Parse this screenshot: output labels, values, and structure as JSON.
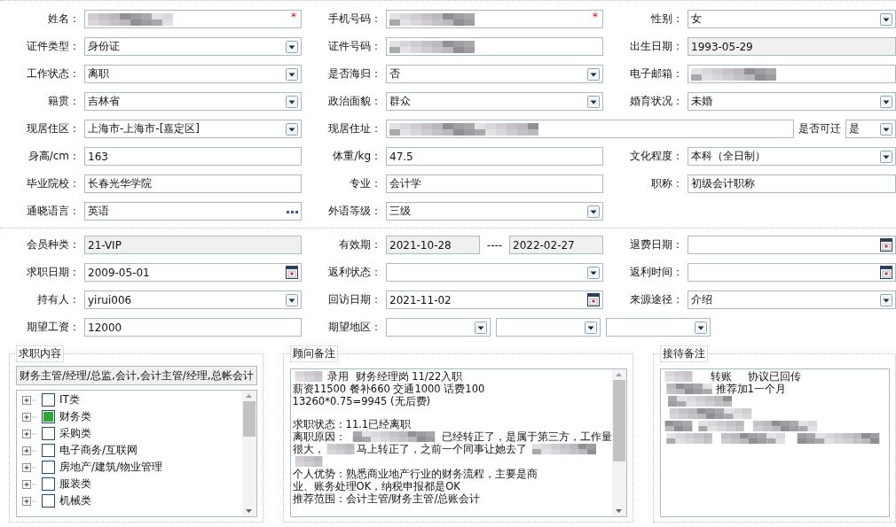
{
  "basic_info": {
    "rows": [
      [
        {
          "label": "姓名：",
          "kind": "text",
          "redacted": true,
          "required_mark": "*"
        },
        {
          "label": "手机号码：",
          "kind": "text",
          "redacted": true,
          "required_mark": "*"
        },
        {
          "label": "性别：",
          "kind": "select",
          "value": "女"
        }
      ],
      [
        {
          "label": "证件类型：",
          "kind": "select",
          "value": "身份证"
        },
        {
          "label": "证件号码：",
          "kind": "text",
          "redacted": true
        },
        {
          "label": "出生日期：",
          "kind": "text",
          "value": "1993-05-29",
          "readonly": true
        }
      ],
      [
        {
          "label": "工作状态：",
          "kind": "select",
          "value": "离职"
        },
        {
          "label": "是否海归：",
          "kind": "select",
          "value": "否"
        },
        {
          "label": "电子邮箱：",
          "kind": "text",
          "redacted": true
        }
      ],
      [
        {
          "label": "籍贯：",
          "kind": "select",
          "value": "吉林省"
        },
        {
          "label": "政治面貌：",
          "kind": "select",
          "value": "群众"
        },
        {
          "label": "婚育状况：",
          "kind": "select",
          "value": "未婚"
        }
      ],
      [
        {
          "label": "现居住区：",
          "kind": "select",
          "value": " 上海市-上海市-[嘉定区]"
        },
        {
          "label": "现居住址：",
          "kind": "wide",
          "redacted": true
        },
        {
          "label": "是否可迁",
          "kind": "select",
          "value": "是"
        }
      ],
      [
        {
          "label": "身高/cm：",
          "kind": "text",
          "value": "163"
        },
        {
          "label": "体重/kg：",
          "kind": "text",
          "value": "47.5"
        },
        {
          "label": "文化程度：",
          "kind": "select",
          "value": "本科（全日制）"
        }
      ],
      [
        {
          "label": "毕业院校：",
          "kind": "text",
          "value": "长春光华学院"
        },
        {
          "label": "专业：",
          "kind": "text",
          "value": "会计学"
        },
        {
          "label": "职称：",
          "kind": "text",
          "value": "初级会计职称"
        }
      ],
      [
        {
          "label": "通晓语言：",
          "kind": "lookup",
          "value": "英语"
        },
        {
          "label": "外语等级：",
          "kind": "select",
          "value": "三级"
        }
      ]
    ]
  },
  "membership": {
    "rows": [
      [
        {
          "label": "会员种类：",
          "kind": "text",
          "value": "21-VIP",
          "readonly": true
        },
        {
          "label": "有效期：",
          "kind": "range",
          "values": [
            "2021-10-28",
            "2022-02-27"
          ],
          "separator": "----",
          "readonly": true
        },
        {
          "label": "退费日期：",
          "kind": "date"
        }
      ],
      [
        {
          "label": "求职日期：",
          "kind": "date",
          "value": "2009-05-01"
        },
        {
          "label": "返利状态：",
          "kind": "select"
        },
        {
          "label": "返利时间：",
          "kind": "date"
        }
      ],
      [
        {
          "label": "持有人：",
          "kind": "select",
          "value": "yirui006"
        },
        {
          "label": "回访日期：",
          "kind": "date",
          "value": "2021-11-02"
        },
        {
          "label": "来源途径：",
          "kind": "select",
          "value": "介绍"
        }
      ],
      [
        {
          "label": "期望工资：",
          "kind": "text",
          "value": "12000"
        },
        {
          "label": "期望地区：",
          "kind": "region",
          "parts": [
            {
              "kind": "select"
            },
            {
              "kind": "select"
            },
            {
              "kind": "select"
            }
          ]
        }
      ]
    ]
  },
  "job_intent": {
    "title": "求职内容",
    "summary": "财务主管/经理/总监,会计,会计主管/经理,总帐会计",
    "categories": [
      {
        "label": "IT类",
        "checked": false,
        "expanded": false
      },
      {
        "label": "财务类",
        "checked": true,
        "expanded": false
      },
      {
        "label": "采购类",
        "checked": false,
        "expanded": false
      },
      {
        "label": "电子商务/互联网",
        "checked": false,
        "expanded": false
      },
      {
        "label": "房地产/建筑/物业管理",
        "checked": false,
        "expanded": false
      },
      {
        "label": "服装类",
        "checked": false,
        "expanded": false
      },
      {
        "label": "机械类",
        "checked": false,
        "expanded": false
      }
    ]
  },
  "consultant_notes": {
    "title": "顾问备注",
    "paragraphs": [
      [
        [
          {
            "kind": "redacted"
          },
          {
            "kind": "text",
            "text": " 录用  财务经理岗 11/22入职"
          }
        ],
        [
          {
            "kind": "text",
            "text": "薪资11500 餐补660 交通1000 话费100"
          }
        ],
        [
          {
            "kind": "text",
            "text": "13260*0.75=9945 (无后费)"
          }
        ]
      ],
      [
        [
          {
            "kind": "text",
            "text": "求职状态：11.1已经离职"
          }
        ],
        [
          {
            "kind": "text",
            "text": "离职原因："
          },
          {
            "kind": "redacted"
          },
          {
            "kind": "text",
            "text": "已经转正了，是属于第三方，工作量"
          }
        ],
        [
          {
            "kind": "text",
            "text": "很大，"
          },
          {
            "kind": "redacted"
          },
          {
            "kind": "text",
            "text": "马上转正了，之前一个同事让她去了"
          },
          {
            "kind": "redacted"
          }
        ],
        [
          {
            "kind": "redacted"
          }
        ],
        [
          {
            "kind": "text",
            "text": "个人优势：熟悉商业地产行业的财务流程，主要是商"
          }
        ],
        [
          {
            "kind": "text",
            "text": "业、账务处理OK，纳税申报都是OK"
          }
        ],
        [
          {
            "kind": "text",
            "text": "推荐范围：会计主管/财务主管/总账会计"
          }
        ]
      ]
    ]
  },
  "reception_notes": {
    "title": "接待备注",
    "paragraphs": [
      [
        [
          {
            "kind": "redacted"
          },
          {
            "kind": "text",
            "text": "     转账     协议已回传"
          }
        ],
        [
          {
            "kind": "redacted"
          },
          {
            "kind": "text",
            "text": "推荐加1一个月"
          }
        ],
        [
          {
            "kind": "redacted"
          }
        ],
        [
          {
            "kind": "redacted"
          }
        ],
        [
          {
            "kind": "redacted"
          },
          {
            "kind": "redacted"
          },
          {
            "kind": "redacted"
          }
        ],
        [
          {
            "kind": "redacted"
          },
          {
            "kind": "redacted"
          },
          {
            "kind": "redacted"
          }
        ]
      ]
    ]
  }
}
